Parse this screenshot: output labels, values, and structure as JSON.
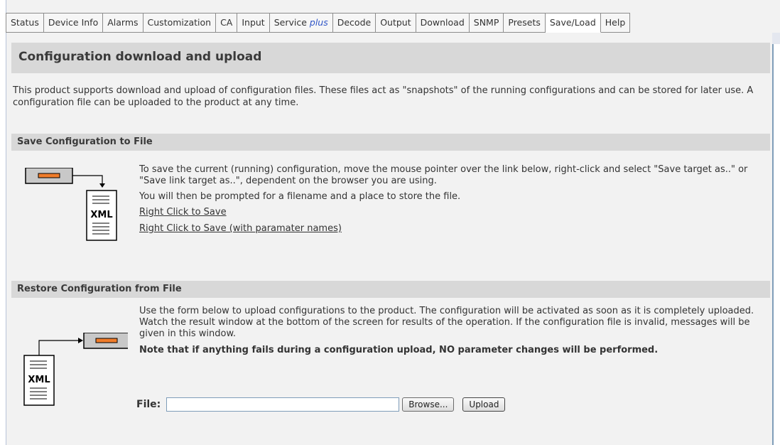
{
  "tabs": [
    {
      "label": "Status"
    },
    {
      "label": "Device Info"
    },
    {
      "label": "Alarms"
    },
    {
      "label": "Customization"
    },
    {
      "label": "CA"
    },
    {
      "label": "Input"
    },
    {
      "label": "Service ",
      "suffix": "plus"
    },
    {
      "label": "Decode"
    },
    {
      "label": "Output"
    },
    {
      "label": "Download"
    },
    {
      "label": "SNMP"
    },
    {
      "label": "Presets"
    },
    {
      "label": "Save/Load",
      "active": true
    },
    {
      "label": "Help"
    }
  ],
  "page": {
    "title": "Configuration download and upload",
    "intro": "This product supports download and upload of configuration files. These files act as \"snapshots\" of the running configurations and can be stored for later use. A configuration file can be uploaded to the product at any time."
  },
  "save_section": {
    "heading": "Save Configuration to File",
    "text1": "To save the current (running) configuration, move the mouse pointer over the link below, right-click and select \"Save target as..\" or \"Save link target as..\", dependent on the browser you are using.",
    "text2": "You will then be prompted for a filename and a place to store the file.",
    "link1": "Right Click to Save",
    "link2": "Right Click to Save (with paramater names)",
    "icon_label": "XML"
  },
  "restore_section": {
    "heading": "Restore Configuration from File",
    "text1": "Use the form below to upload configurations to the product. The configuration will be activated as soon as it is completely uploaded. Watch the result window at the bottom of the screen for results of the operation. If the configuration file is invalid, messages will be given in this window.",
    "note": "Note that if anything fails during a configuration upload, NO parameter changes will be performed.",
    "icon_label": "XML",
    "file_label": "File:",
    "file_value": "",
    "browse_label": "Browse...",
    "upload_label": "Upload"
  },
  "colors": {
    "section_bg": "#d8d8d8",
    "device_orange": "#f07c2a",
    "link_plus": "#2f55c7"
  }
}
